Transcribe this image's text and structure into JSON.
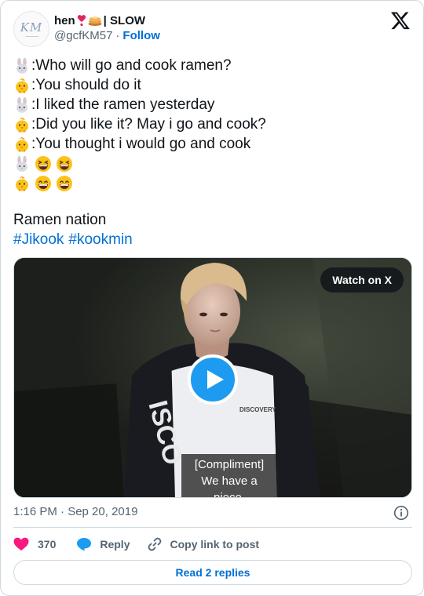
{
  "author": {
    "display_name": "hen",
    "name_suffix": "| SLOW",
    "handle": "@gcfKM57",
    "separator": "·",
    "follow_label": "Follow",
    "avatar_text": "KM"
  },
  "tweet": {
    "lines": [
      {
        "speaker": "rabbit",
        "text": ":Who will go and cook ramen?"
      },
      {
        "speaker": "chick",
        "text": ":You should do it"
      },
      {
        "speaker": "rabbit",
        "text": ":I liked the ramen yesterday"
      },
      {
        "speaker": "chick",
        "text": ":Did you like it? May i go and cook?"
      },
      {
        "speaker": "chick",
        "text": ":You thought i would go and cook"
      }
    ],
    "closing_text": "Ramen nation",
    "hashtags": [
      "#Jikook",
      "#kookmin"
    ]
  },
  "media": {
    "watch_label": "Watch on X",
    "caption_line1": "[Compliment]",
    "caption_line2": "We have a piece."
  },
  "timestamp": "1:16 PM · Sep 20, 2019",
  "actions": {
    "like_count": "370",
    "reply_label": "Reply",
    "copy_label": "Copy link to post"
  },
  "read_replies_label": "Read 2 replies",
  "colors": {
    "link": "#006fd6",
    "like": "#f91880",
    "play": "#1d9bf0",
    "muted": "#536471"
  }
}
